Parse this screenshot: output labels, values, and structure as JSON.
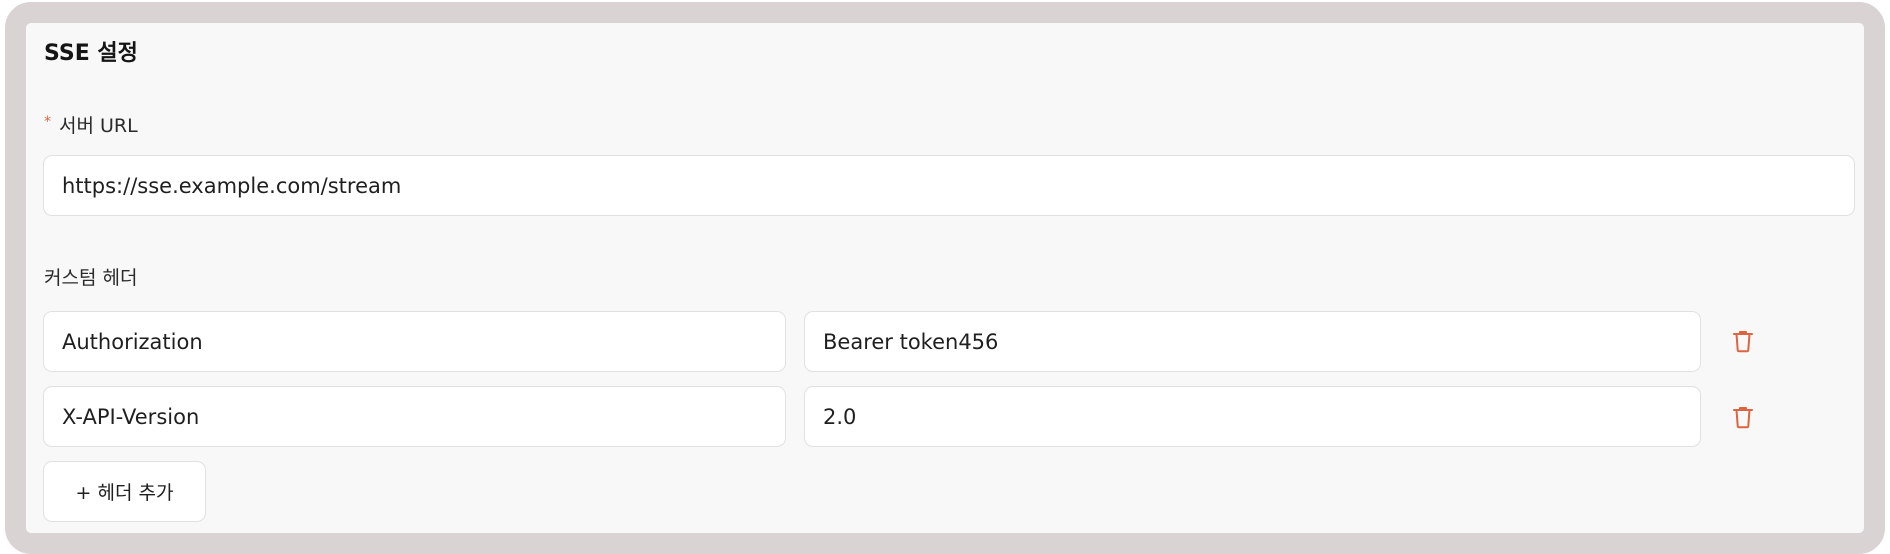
{
  "section": {
    "title": "SSE 설정"
  },
  "server_url": {
    "required_mark": "*",
    "label": "서버 URL",
    "value": "https://sse.example.com/stream"
  },
  "custom_headers": {
    "label": "커스텀 헤더",
    "rows": [
      {
        "key": "Authorization",
        "value": "Bearer token456",
        "delete_icon": "trash-icon"
      },
      {
        "key": "X-API-Version",
        "value": "2.0",
        "delete_icon": "trash-icon"
      }
    ],
    "add_button_label": "+ 헤더 추가"
  },
  "colors": {
    "frame_border": "#d9d3d3",
    "panel_background": "#f8f8f8",
    "required_accent": "#e0633f",
    "delete_icon": "#e0633f"
  }
}
